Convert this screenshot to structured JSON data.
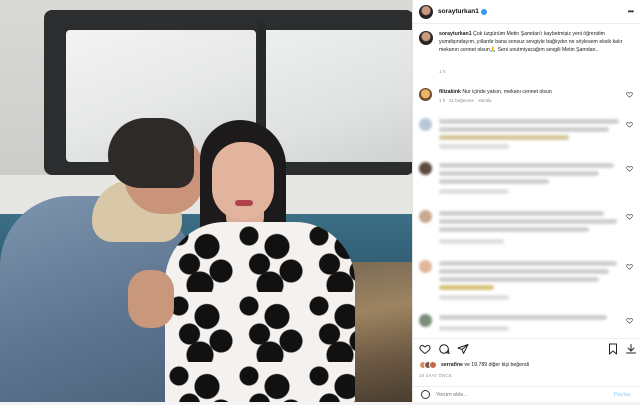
{
  "post": {
    "username": "sorayturkan1",
    "verified": true,
    "caption": {
      "author": "sorayturkan1",
      "text": "Çok üzgünüm Metin Şamdan'ı kaybetmişiz yeni öğrendim yumdişındayım..yıllardır bana sonsuz sevgiyle bağlıydın ne söylesem eksik kalır mekanın cennet olsun🙏 Seni unutmiyacağım sevgili Metin Şamdan..",
      "time": "1 h"
    },
    "comments": [
      {
        "author": "filizakink",
        "text": "Nur içinde yatsın, mekanı cennet olsun",
        "time": "1 h",
        "likes": "31 beğenme",
        "reply": "Yanıtla"
      }
    ],
    "likes": {
      "first_liker": "serrafine",
      "rest": "ve 19.789 diğer kişi beğendi"
    },
    "date": "18 SAAT ÖNCE",
    "comment_input": {
      "placeholder": "Yorum ekle..."
    },
    "post_button": "Paylaş"
  },
  "colors": {
    "verified": "#3897f0",
    "post_disabled": "#b3dbff"
  },
  "icons": [
    "more-icon",
    "heart-icon",
    "comment-icon",
    "share-icon",
    "bookmark-icon",
    "download-icon",
    "emoji-icon"
  ]
}
